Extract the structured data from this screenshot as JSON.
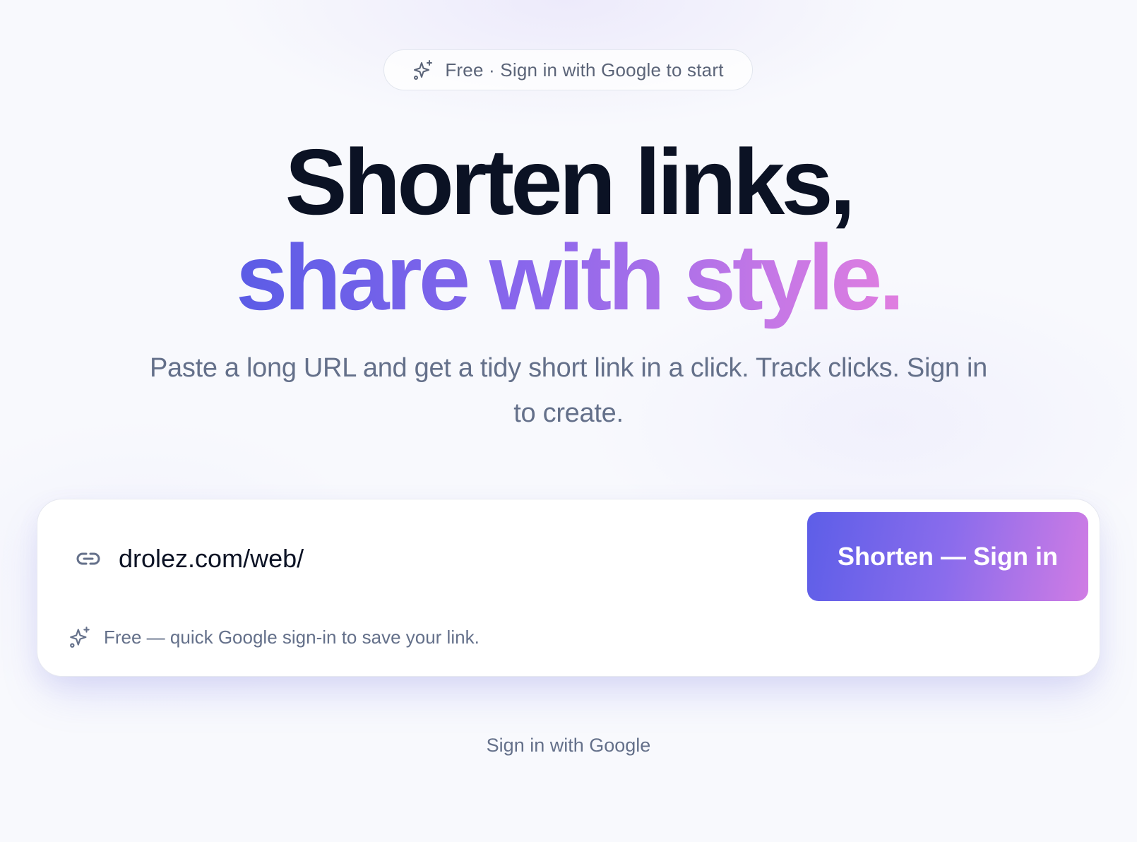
{
  "badge": {
    "icon": "sparkles-icon",
    "text": "Free · Sign in with Google to start"
  },
  "hero": {
    "headline_line1": "Shorten links,",
    "headline_line2": "share with style.",
    "subtitle": "Paste a long URL and get a tidy short link in a click. Track clicks. Sign in to create."
  },
  "shortener": {
    "link_icon": "link-icon",
    "url_value": "drolez.com/web/",
    "button_label": "Shorten — Sign in",
    "note_icon": "sparkles-icon",
    "note": "Free — quick Google sign-in to save your link."
  },
  "footer": {
    "signin_link": "Sign in with Google"
  },
  "colors": {
    "heading": "#0b1224",
    "muted_text": "#64708a",
    "gradient_start": "#5b5ce6",
    "gradient_mid": "#8b67ec",
    "gradient_end": "#e07ee0",
    "card_background": "#ffffff",
    "page_background": "#f8f9fd"
  }
}
